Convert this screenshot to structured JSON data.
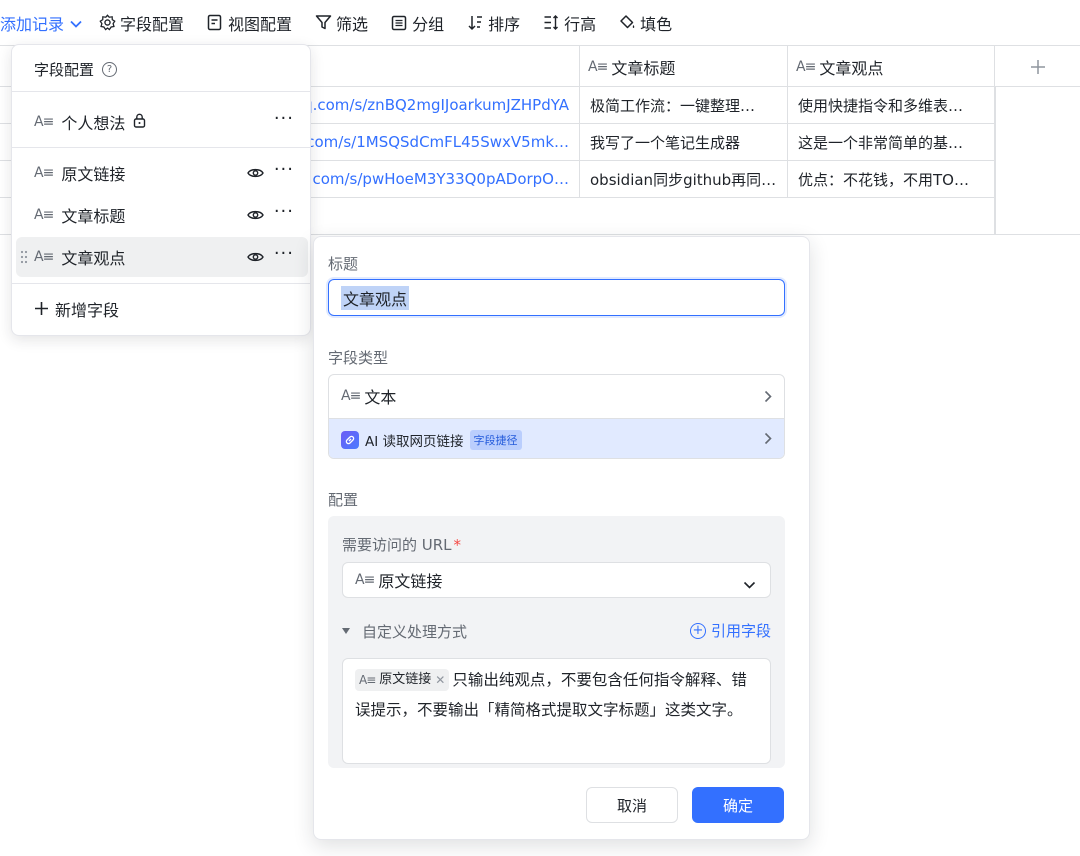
{
  "toolbar": {
    "add_record": "添加记录",
    "field_config": "字段配置",
    "view_config": "视图配置",
    "filter": "筛选",
    "group": "分组",
    "sort": "排序",
    "row_height": "行高",
    "fill_color": "填色"
  },
  "grid": {
    "headers": [
      "文章标题",
      "文章观点"
    ],
    "rows": [
      {
        "link": "q.com/s/znBQ2mgIJoarkumJZHPdYA",
        "title": "极简工作流：一键整理…",
        "view": "使用快捷指令和多维表…"
      },
      {
        "link": "q.com/s/1MSQSdCmFL45SwxV5mk…",
        "title": "我写了一个笔记生成器",
        "view": "这是一个非常简单的基…"
      },
      {
        "link": "q.com/s/pwHoeM3Y33Q0pADorpO…",
        "title": "obsidian同步github再同…",
        "view": "优点：不花钱，不用TO…"
      }
    ]
  },
  "field_panel": {
    "title": "字段配置",
    "help_glyph": "?",
    "primary": "个人想法",
    "fields": [
      "原文链接",
      "文章标题",
      "文章观点"
    ],
    "add_field": "新增字段",
    "more_glyph": "···"
  },
  "text_icon": "A≡",
  "editor": {
    "title_label": "标题",
    "title_value": "文章观点",
    "type_label": "字段类型",
    "type_text": "文本",
    "ai_option": "AI 读取网页链接",
    "ai_badge": "字段捷径",
    "config_label": "配置",
    "url_label": "需要访问的 URL",
    "required_mark": "*",
    "url_value": "原文链接",
    "custom_label": "自定义处理方式",
    "ref_field": "引用字段",
    "prompt_chip": "原文链接",
    "prompt_text": "只输出纯观点，不要包含任何指令解释、错误提示，不要输出「精简格式提取文字标题」这类文字。",
    "cancel": "取消",
    "confirm": "确定"
  }
}
